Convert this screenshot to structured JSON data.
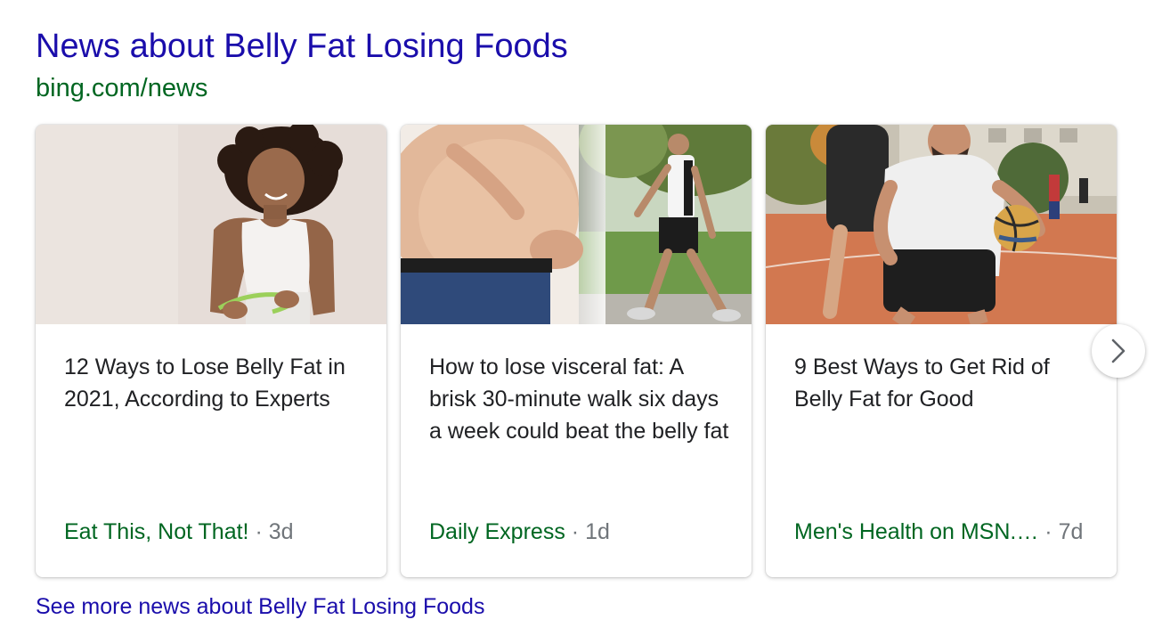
{
  "header": {
    "title": "News about Belly Fat Losing Foods",
    "source": "bing.com/news"
  },
  "cards": [
    {
      "headline": "12 Ways to Lose Belly Fat in 2021, According to Experts",
      "source": "Eat This, Not That!",
      "separator": "·",
      "age": "3d"
    },
    {
      "headline": "How to lose visceral fat: A brisk 30-minute walk six days a week could beat the belly fat",
      "source": "Daily Express",
      "separator": "·",
      "age": "1d"
    },
    {
      "headline": "9 Best Ways to Get Rid of Belly Fat for Good",
      "source": "Men's Health on MSN.…",
      "separator": "·",
      "age": "7d"
    }
  ],
  "controls": {
    "next_icon": "chevron-right-icon"
  },
  "footer": {
    "see_more": "See more news about Belly Fat Losing Foods"
  },
  "colors": {
    "title_link": "#1a0dab",
    "source_green": "#006621",
    "headline_text": "#202124",
    "meta_gray": "#70757a"
  }
}
